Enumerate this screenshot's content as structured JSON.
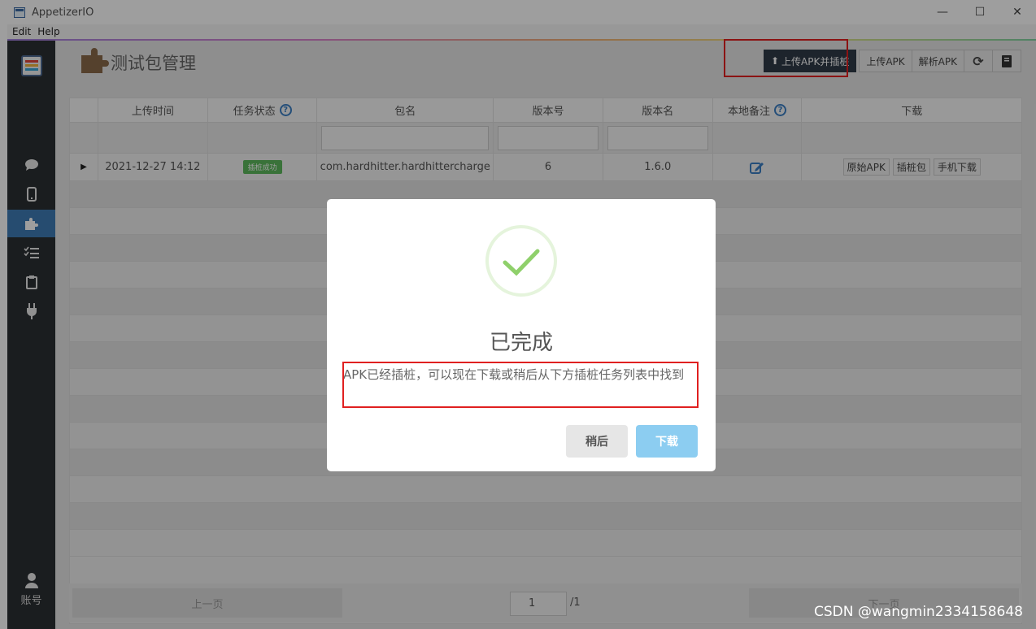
{
  "window": {
    "title": "AppetizerIO"
  },
  "menu": {
    "items": [
      "Edit",
      "Help"
    ]
  },
  "sidebar": {
    "account_label": "账号"
  },
  "header": {
    "title": "测试包管理",
    "upload_instrument": "上传APK并插桩",
    "upload": "上传APK",
    "parse": "解析APK"
  },
  "table": {
    "columns": [
      "上传时间",
      "任务状态",
      "包名",
      "版本号",
      "版本名",
      "本地备注",
      "下载"
    ],
    "rows": [
      {
        "time": "2021-12-27 14:12",
        "status": "插桩成功",
        "package": "com.hardhitter.hardhittercharge",
        "version_code": "6",
        "version_name": "1.6.0",
        "downloads": [
          "原始APK",
          "插桩包",
          "手机下载"
        ]
      }
    ]
  },
  "pager": {
    "prev": "上一页",
    "next": "下一页",
    "current_page": "1",
    "total": "/1"
  },
  "dialog": {
    "title": "已完成",
    "message": "APK已经插桩，可以现在下载或稍后从下方插桩任务列表中找到",
    "later": "稍后",
    "download": "下载"
  },
  "watermark": "CSDN @wangmin2334158648",
  "colors": {
    "accent": "#3e7bb5",
    "success": "#5cb85c",
    "primary_btn": "#2f3b48",
    "download_btn": "#8ccdf1",
    "highlight": "#e02020"
  }
}
